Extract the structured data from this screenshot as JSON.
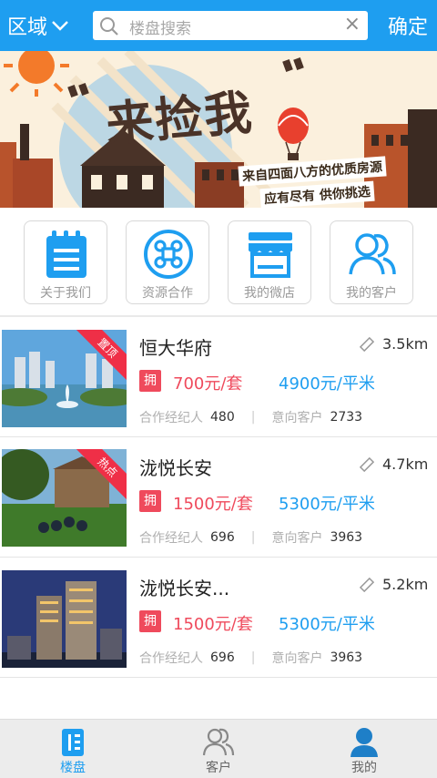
{
  "header": {
    "area_label": "区域",
    "search_placeholder": "楼盘搜索",
    "confirm_label": "确定"
  },
  "banner": {
    "title": "来捡我",
    "line1": "来自四面八方的优质房源",
    "line2": "应有尽有 供你挑选"
  },
  "quick": [
    {
      "label": "关于我们",
      "icon": "notepad-icon"
    },
    {
      "label": "资源合作",
      "icon": "command-icon"
    },
    {
      "label": "我的微店",
      "icon": "shop-icon"
    },
    {
      "label": "我的客户",
      "icon": "customers-icon"
    }
  ],
  "listings": [
    {
      "name": "恒大华府",
      "distance": "3.5km",
      "tag": "拥",
      "price_set": "700元/套",
      "price_sqm": "4900元/平米",
      "agents_label": "合作经纪人",
      "agents": "480",
      "clients_label": "意向客户",
      "clients": "2733",
      "ribbon": "置顶"
    },
    {
      "name": "泷悦长安",
      "distance": "4.7km",
      "tag": "拥",
      "price_set": "1500元/套",
      "price_sqm": "5300元/平米",
      "agents_label": "合作经纪人",
      "agents": "696",
      "clients_label": "意向客户",
      "clients": "3963",
      "ribbon": "热点"
    },
    {
      "name": "泷悦长安...",
      "distance": "5.2km",
      "tag": "拥",
      "price_set": "1500元/套",
      "price_sqm": "5300元/平米",
      "agents_label": "合作经纪人",
      "agents": "696",
      "clients_label": "意向客户",
      "clients": "3963",
      "ribbon": ""
    }
  ],
  "tabs": [
    {
      "label": "楼盘",
      "icon": "building-icon",
      "active": true
    },
    {
      "label": "客户",
      "icon": "customers-icon",
      "active": false
    },
    {
      "label": "我的",
      "icon": "profile-icon",
      "active": false
    }
  ],
  "colors": {
    "primary": "#1e9ef0",
    "accent_red": "#ef4a5c",
    "ribbon_red": "#ef2f47"
  }
}
